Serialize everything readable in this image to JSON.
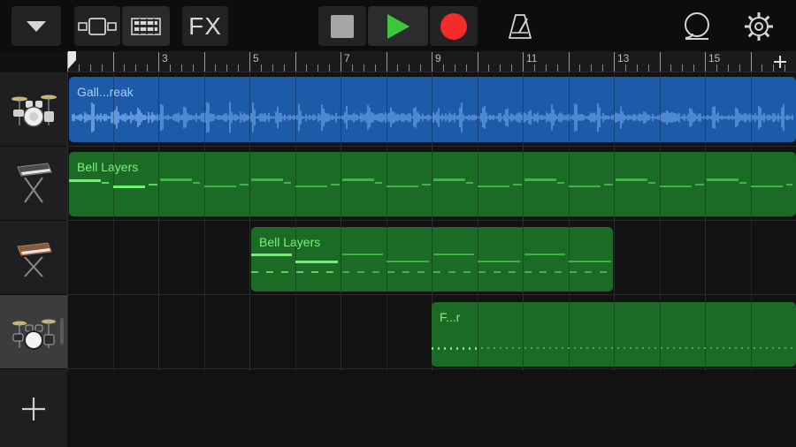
{
  "toolbar": {
    "fx_label": "FX",
    "icons": [
      "browser-dropdown-icon",
      "instrument-view-toggle-icon",
      "tracks-view-icon",
      "stop-icon",
      "play-icon",
      "record-icon",
      "metronome-icon",
      "loop-icon",
      "settings-gear-icon"
    ],
    "colors": {
      "play": "#3ec63e",
      "record": "#f22a2a",
      "stop": "#a7a7a7"
    }
  },
  "ruler": {
    "bar_numbers": [
      "3",
      "5",
      "7",
      "9",
      "11",
      "13",
      "15"
    ],
    "add_section_label": "+"
  },
  "tracks": [
    {
      "instrument": "drum-kit",
      "icon": "drum-kit-icon",
      "selected": false
    },
    {
      "instrument": "keyboard",
      "icon": "keyboard-icon",
      "selected": false
    },
    {
      "instrument": "keyboard",
      "icon": "keyboard-icon",
      "selected": false
    },
    {
      "instrument": "drum-kit",
      "icon": "drum-kit-icon",
      "selected": true
    }
  ],
  "regions": [
    {
      "track": 1,
      "type": "audio",
      "label": "Gall...reak",
      "color": "#1d5aa8"
    },
    {
      "track": 2,
      "type": "midi",
      "label": "Bell Layers",
      "color": "#1b6b27"
    },
    {
      "track": 3,
      "type": "midi",
      "label": "Bell Layers",
      "color": "#1b6b27"
    },
    {
      "track": 4,
      "type": "midi",
      "label": "F...r",
      "color": "#1b6b27"
    }
  ],
  "add_track_label": "+"
}
